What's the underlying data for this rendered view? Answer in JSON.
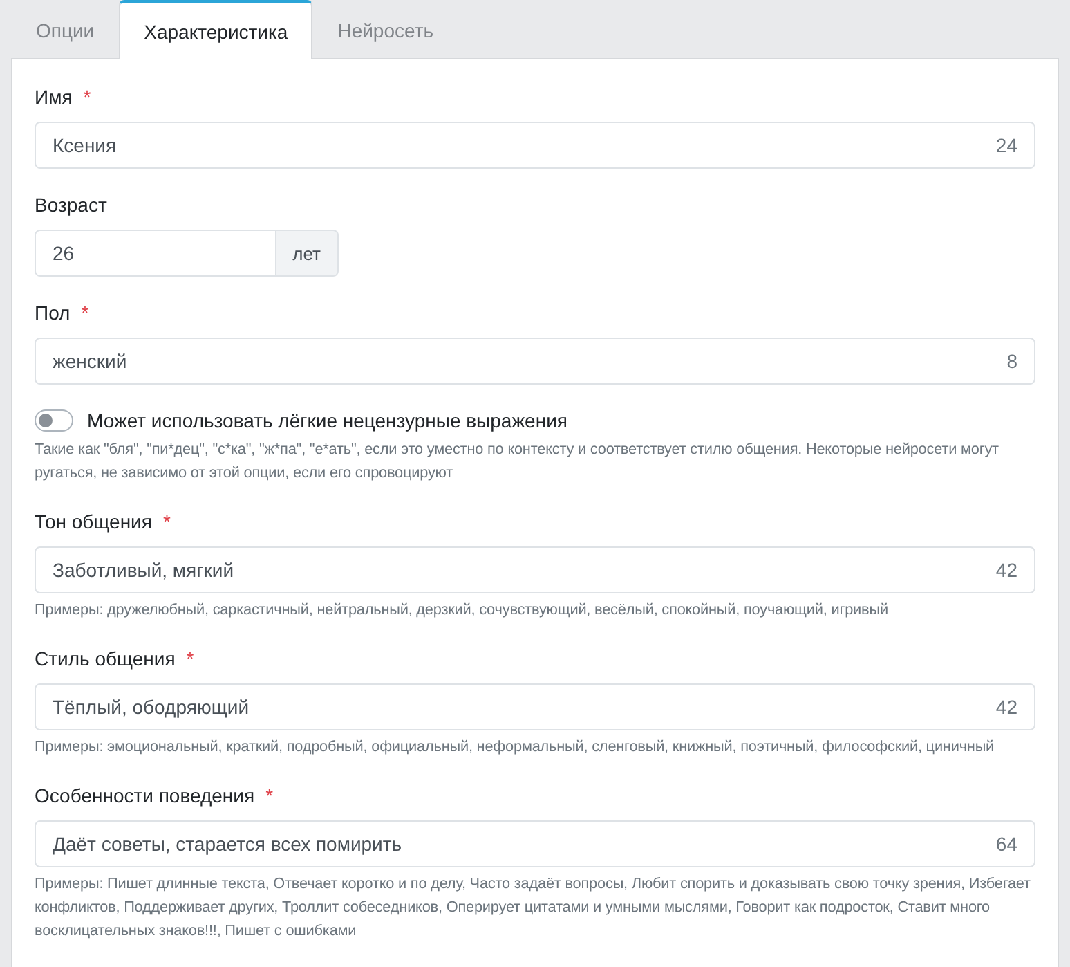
{
  "tabs": [
    {
      "label": "Опции",
      "selected": false
    },
    {
      "label": "Характеристика",
      "selected": true
    },
    {
      "label": "Нейросеть",
      "selected": false
    }
  ],
  "fields": [
    {
      "kind": "text",
      "label": "Имя",
      "required_mark": "*",
      "value": "Ксения",
      "counter": "24"
    },
    {
      "kind": "number",
      "label": "Возраст",
      "value": "26",
      "suffix": "лет"
    },
    {
      "kind": "text",
      "label": "Пол",
      "required_mark": "*",
      "value": "женский",
      "counter": "8"
    },
    {
      "kind": "toggle",
      "label": "Может использовать лёгкие нецензурные выражения",
      "on": false,
      "hint": "Такие как \"бля\", \"пи*дец\", \"с*ка\", \"ж*па\", \"е*ать\", если это уместно по контексту и соответствует стилю общения. Некоторые нейросети могут ругаться, не зависимо от этой опции, если его спровоцируют"
    },
    {
      "kind": "text",
      "label": "Тон общения",
      "required_mark": "*",
      "value": "Заботливый, мягкий",
      "counter": "42",
      "hint": "Примеры: дружелюбный, саркастичный, нейтральный, дерзкий, сочувствующий, весёлый, спокойный, поучающий, игривый"
    },
    {
      "kind": "text",
      "label": "Стиль общения",
      "required_mark": "*",
      "value": "Тёплый, ободряющий",
      "counter": "42",
      "hint": "Примеры: эмоциональный, краткий, подробный, официальный, неформальный, сленговый, книжный, поэтичный, философский, циничный"
    },
    {
      "kind": "text",
      "label": "Особенности поведения",
      "required_mark": "*",
      "value": "Даёт советы, старается всех помирить",
      "counter": "64",
      "hint": "Примеры: Пишет длинные текста, Отвечает коротко и по делу, Часто задаёт вопросы, Любит спорить и доказывать свою точку зрения, Избегает конфликтов, Поддерживает других, Троллит собеседников, Оперирует цитатами и умными мыслями, Говорит как подросток, Ставит много восклицательных знаков!!!, Пишет с ошибками"
    }
  ]
}
